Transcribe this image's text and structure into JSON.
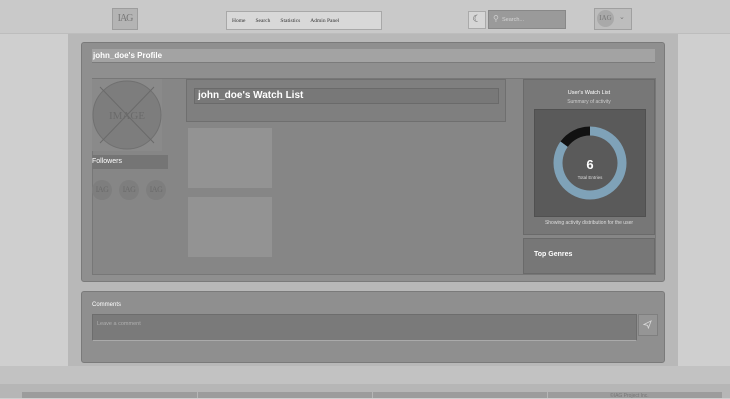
{
  "header": {
    "logo_text": "IAG",
    "nav": [
      "Home",
      "Search",
      "Statistics",
      "Admin Panel"
    ],
    "search_placeholder": "Search...",
    "theme_icon": "moon-icon",
    "user_avatar_text": "IAG"
  },
  "profile": {
    "title": "john_doe's Profile",
    "avatar_text": "IMAGE",
    "followers_label": "Followers",
    "followers": [
      "IAG",
      "IAG",
      "IAG"
    ],
    "watchlist_title": "john_doe's Watch List"
  },
  "stats": {
    "title": "User's Watch List",
    "subtitle": "Summary of activity",
    "total": "6",
    "total_label": "Total Entries",
    "footer": "Showing activity distribution for the user",
    "segments": [
      {
        "fraction": 0.85,
        "color": "#7fa2b8"
      },
      {
        "fraction": 0.15,
        "color": "#111111"
      }
    ]
  },
  "genres": {
    "title": "Top Genres"
  },
  "comments": {
    "label": "Comments",
    "placeholder": "Leave a comment",
    "send_icon": "send-icon"
  },
  "footer": {
    "copyright": "©IAG Project Inc."
  }
}
